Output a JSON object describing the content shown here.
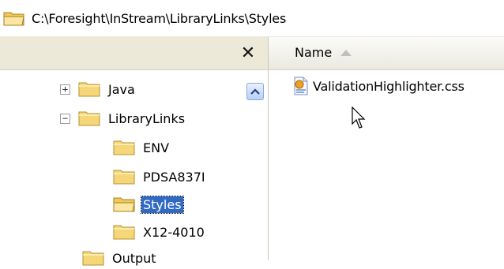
{
  "address_bar": {
    "path": "C:\\Foresight\\InStream\\LibraryLinks\\Styles"
  },
  "folder_pane": {
    "close_label": "✕",
    "tree": [
      {
        "label": "Java",
        "expander": "+",
        "selected": false
      },
      {
        "label": "LibraryLinks",
        "expander": "−",
        "selected": false
      },
      {
        "label": "ENV",
        "selected": false
      },
      {
        "label": "PDSA837I",
        "selected": false
      },
      {
        "label": "Styles",
        "selected": true
      },
      {
        "label": "X12-4010",
        "selected": false
      },
      {
        "label": "Output",
        "selected": false
      }
    ]
  },
  "file_list": {
    "columns": [
      {
        "label": "Name",
        "sort": "ascending"
      }
    ],
    "files": [
      {
        "name": "ValidationHighlighter.css"
      }
    ]
  },
  "colors": {
    "folder_yellow": "#f5d77a",
    "folder_outline": "#b8912a",
    "selection_blue": "#316ac5",
    "header_bg": "#ece9d8"
  }
}
